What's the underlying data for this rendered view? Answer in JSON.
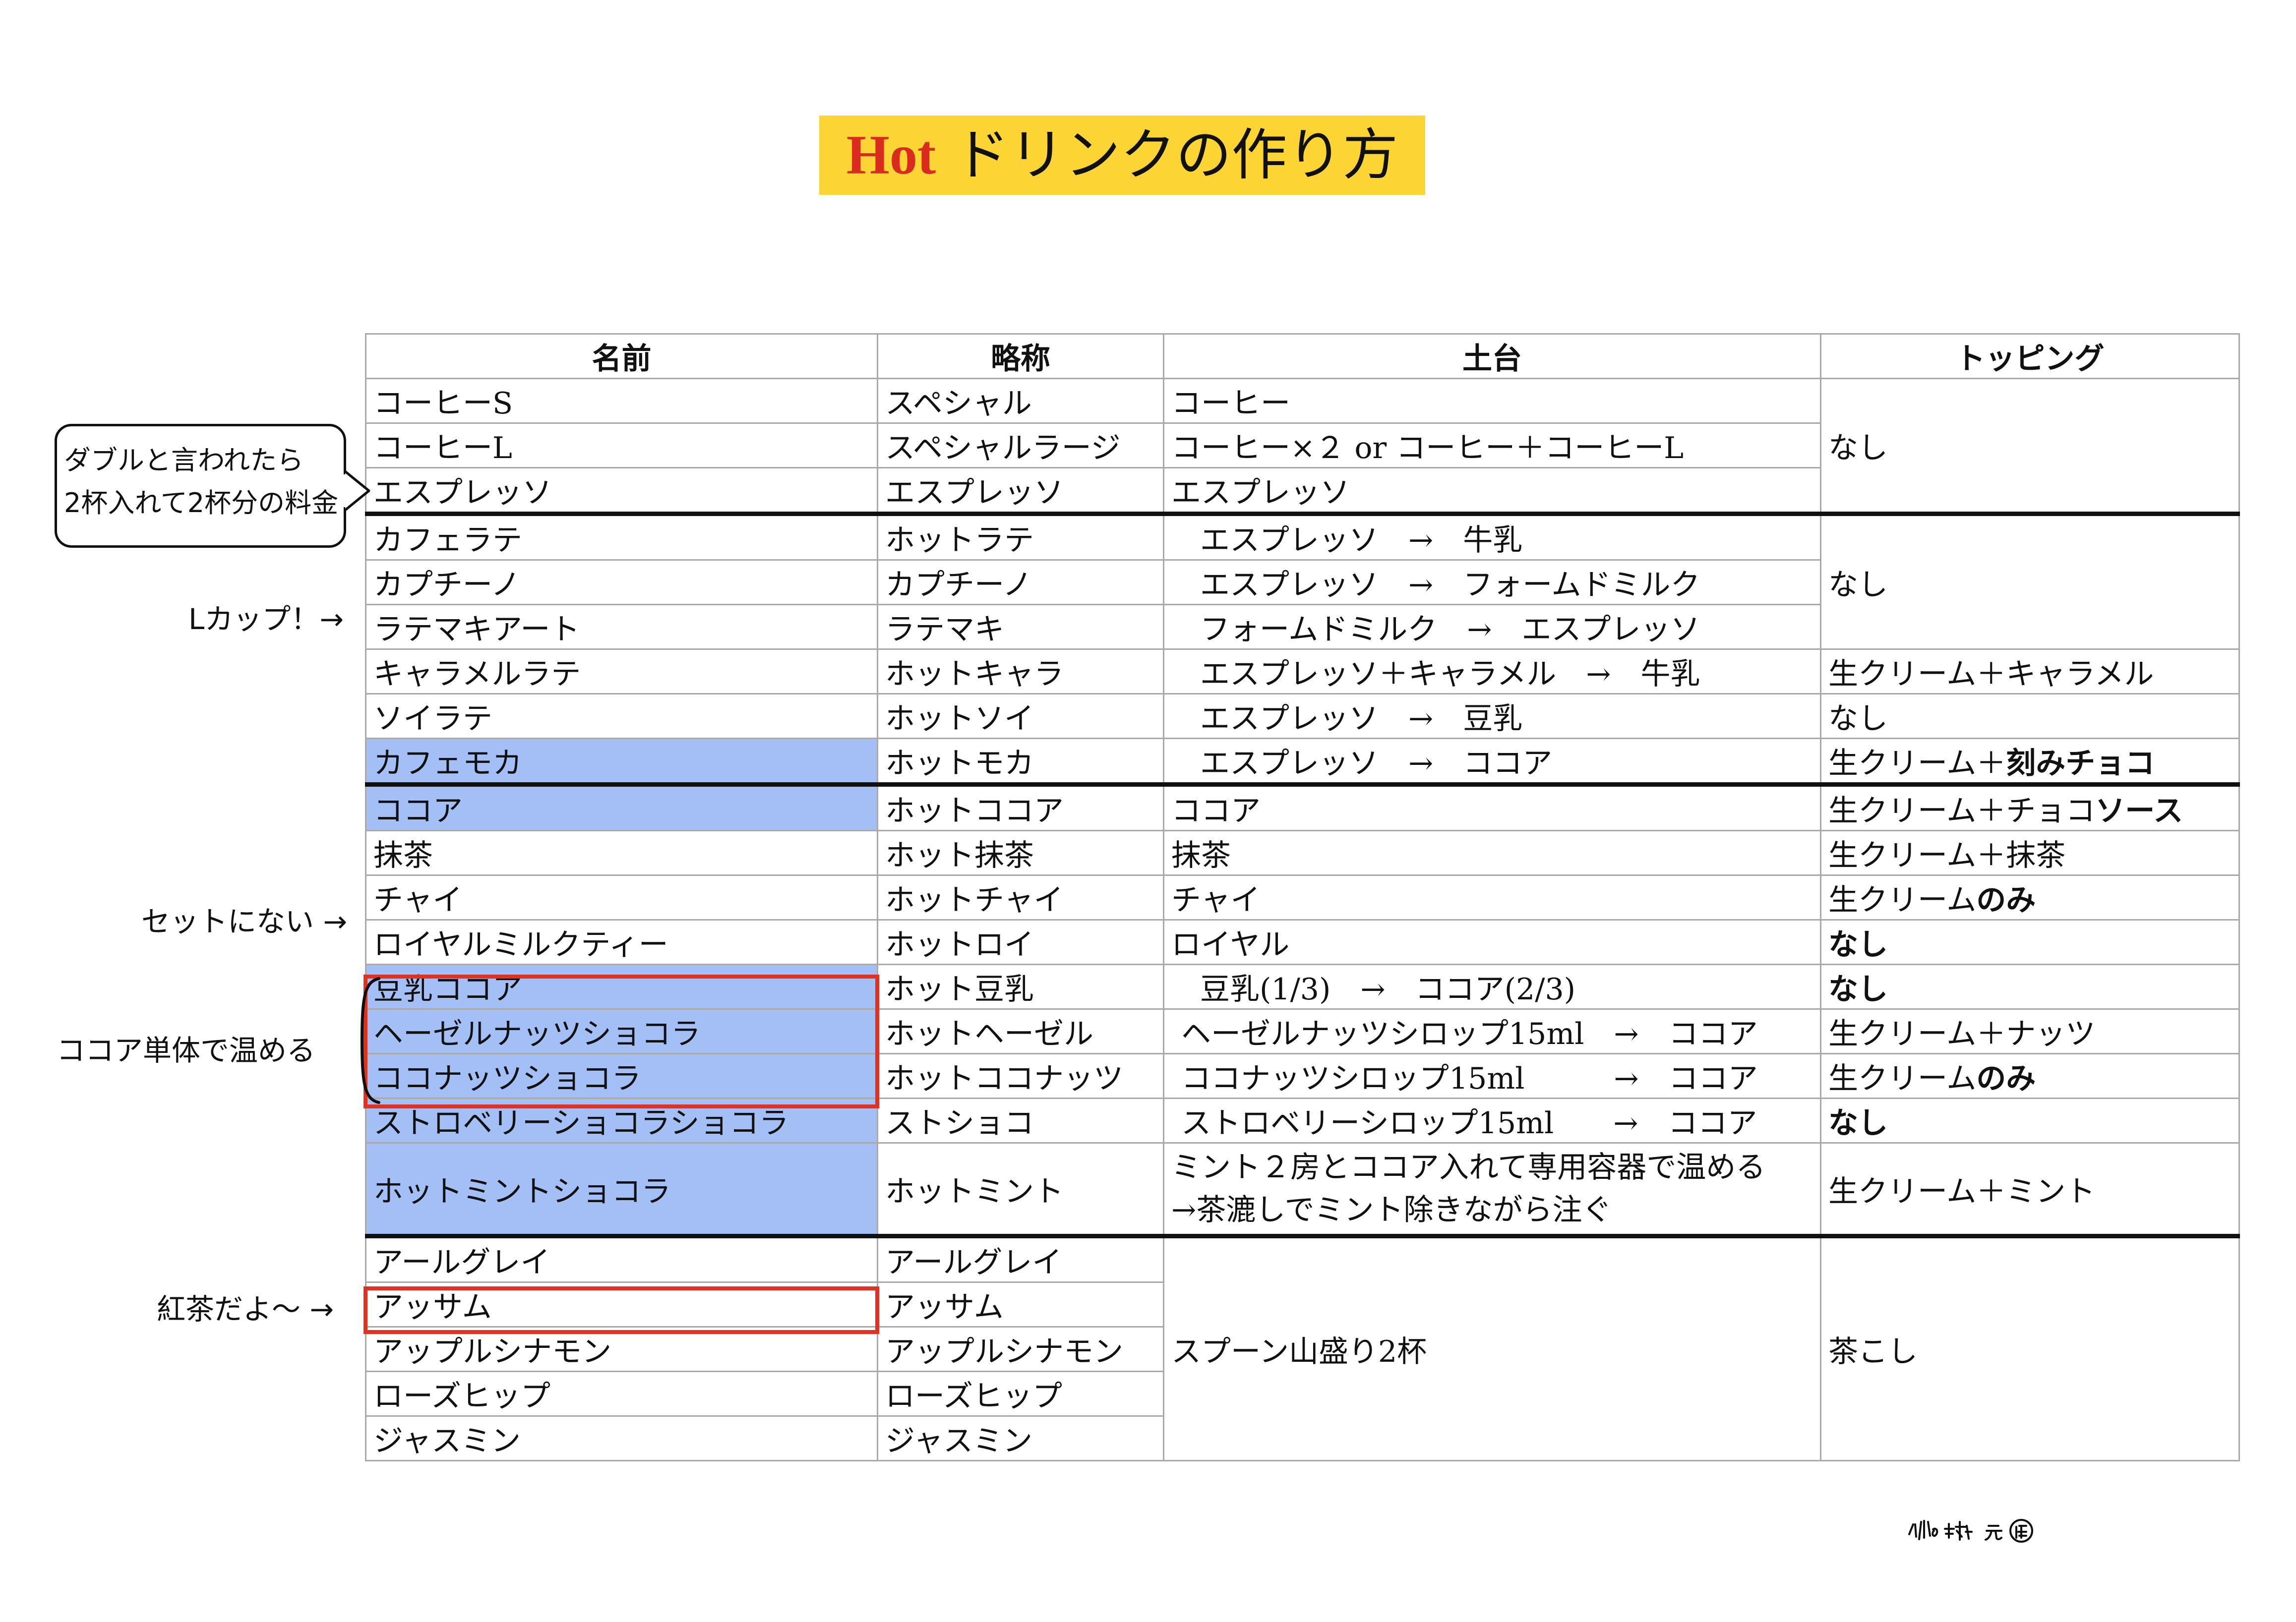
{
  "title": {
    "hot": "Hot",
    "rest": "ドリンクの作り方"
  },
  "table": {
    "headers": [
      "名前",
      "略称",
      "土台",
      "トッピング"
    ],
    "coffee": {
      "rows": [
        {
          "name": "コーヒーS",
          "abbr": "スペシャル",
          "base": "コーヒー"
        },
        {
          "name": "コーヒーL",
          "abbr": "スペシャルラージ",
          "base": "コーヒー×２ or コーヒー＋コーヒーL"
        },
        {
          "name": "エスプレッソ",
          "abbr": "エスプレッソ",
          "base": "エスプレッソ"
        }
      ],
      "topping": "なし"
    },
    "latte": {
      "rows": [
        {
          "name": "カフェラテ",
          "abbr": "ホットラテ",
          "base": "エスプレッソ　→　牛乳"
        },
        {
          "name": "カプチーノ",
          "abbr": "カプチーノ",
          "base": "エスプレッソ　→　フォームドミルク"
        },
        {
          "name": "ラテマキアート",
          "abbr": "ラテマキ",
          "base": "フォームドミルク　→　エスプレッソ"
        },
        {
          "name": "キャラメルラテ",
          "abbr": "ホットキャラ",
          "base": "エスプレッソ＋キャラメル　→　牛乳",
          "topping": "生クリーム＋キャラメル"
        },
        {
          "name": "ソイラテ",
          "abbr": "ホットソイ",
          "base": "エスプレッソ　→　豆乳",
          "topping": "なし"
        },
        {
          "name": "カフェモカ",
          "abbr": "ホットモカ",
          "base": "エスプレッソ　→　ココア",
          "topping_a": "生クリーム＋",
          "topping_b": "刻みチョコ"
        }
      ],
      "shared_topping": "なし"
    },
    "cocoa": {
      "rows": [
        {
          "name": "ココア",
          "abbr": "ホットココア",
          "base": "ココア",
          "topping_a": "生クリーム＋チョコ",
          "topping_b": "ソース"
        },
        {
          "name": "抹茶",
          "abbr": "ホット抹茶",
          "base": "抹茶",
          "topping": "生クリーム＋抹茶"
        },
        {
          "name": "チャイ",
          "abbr": "ホットチャイ",
          "base": "チャイ",
          "topping_a": "生クリーム",
          "topping_b": "のみ"
        },
        {
          "name": "ロイヤルミルクティー",
          "abbr": "ホットロイ",
          "base": "ロイヤル",
          "topping": "なし"
        },
        {
          "name": "豆乳ココア",
          "abbr": "ホット豆乳",
          "base": "豆乳(1/3)　→　ココア(2/3)",
          "topping": "なし"
        },
        {
          "name": "ヘーゼルナッツショコラ",
          "abbr": "ホットヘーゼル",
          "base": "ヘーゼルナッツシロップ15ml　→　ココア",
          "topping": "生クリーム＋ナッツ"
        },
        {
          "name": "ココナッツショコラ",
          "abbr": "ホットココナッツ",
          "base": "ココナッツシロップ15ml　　　→　ココア",
          "topping_a": "生クリーム",
          "topping_b": "のみ"
        },
        {
          "name": "ストロベリーショコラショコラ",
          "abbr": "ストショコ",
          "base": "ストロベリーシロップ15ml　　→　ココア",
          "topping": "なし"
        },
        {
          "name": "ホットミントショコラ",
          "abbr": "ホットミント",
          "base_line1": "ミント２房とココア入れて専用容器で温める",
          "base_line2": "→茶漉しでミント除きながら注ぐ",
          "topping": "生クリーム＋ミント"
        }
      ]
    },
    "tea": {
      "rows": [
        {
          "name": "アールグレイ",
          "abbr": "アールグレイ"
        },
        {
          "name": "アッサム",
          "abbr": "アッサム"
        },
        {
          "name": "アップルシナモン",
          "abbr": "アップルシナモン"
        },
        {
          "name": "ローズヒップ",
          "abbr": "ローズヒップ"
        },
        {
          "name": "ジャスミン",
          "abbr": "ジャスミン"
        }
      ],
      "base": "スプーン山盛り2杯",
      "topping": "茶こし"
    }
  },
  "annotations": {
    "double_line1": "ダブルと言われたら",
    "double_line2": "2杯入れて2杯分の料金",
    "lcup": "Lカップ！→",
    "not_set": "セットにない →",
    "cocoa_heat": "ココア単体で温める",
    "tea": "紅茶だよ〜 →"
  },
  "colors": {
    "title_bg": "#fcd535",
    "hot_text": "#d92b1e",
    "highlight": "#a3bff6",
    "red_box": "#e03222"
  }
}
